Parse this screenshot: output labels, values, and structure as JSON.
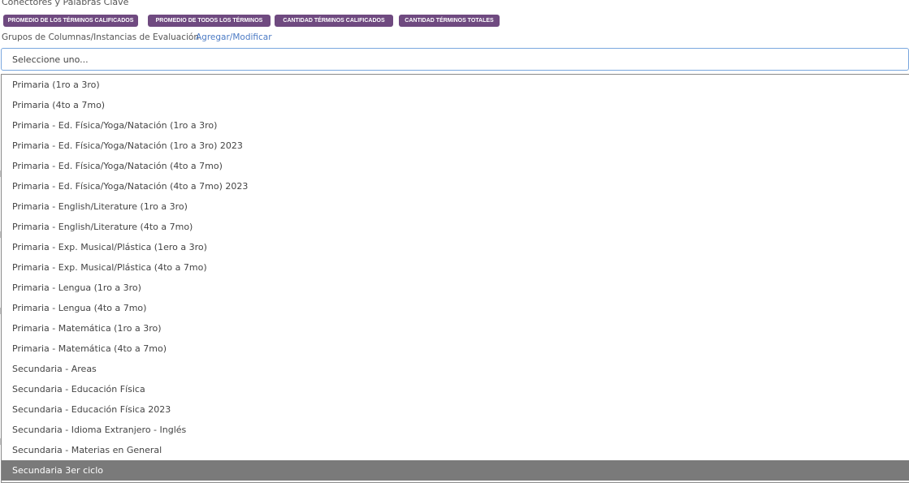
{
  "section_title": "Conectores y Palabras Clave",
  "report_buttons": [
    "PROMEDIO DE LOS TÉRMINOS CALIFICADOS",
    "PROMEDIO DE TODOS LOS TÉRMINOS",
    "CANTIDAD TÉRMINOS CALIFICADOS",
    "CANTIDAD TÉRMINOS TOTALES"
  ],
  "groups": {
    "label": "Grupos de Columnas/Instancias de Evaluación",
    "link": "Agregar/Modificar"
  },
  "select": {
    "placeholder": "Seleccione uno...",
    "options": [
      "Primaria (1ro a 3ro)",
      "Primaria (4to a 7mo)",
      "Primaria - Ed. Física/Yoga/Natación (1ro a 3ro)",
      "Primaria - Ed. Física/Yoga/Natación (1ro a 3ro) 2023",
      "Primaria - Ed. Física/Yoga/Natación (4to a 7mo)",
      "Primaria - Ed. Física/Yoga/Natación (4to a 7mo) 2023",
      "Primaria - English/Literature (1ro a 3ro)",
      "Primaria - English/Literature (4to a 7mo)",
      "Primaria - Exp. Musical/Plástica (1ero a 3ro)",
      "Primaria - Exp. Musical/Plástica (4to a 7mo)",
      "Primaria - Lengua (1ro a 3ro)",
      "Primaria - Lengua (4to a 7mo)",
      "Primaria - Matemática (1ro a 3ro)",
      "Primaria - Matemática (4to a 7mo)",
      "Secundaria - Areas",
      "Secundaria - Educación Física",
      "Secundaria - Educación Física 2023",
      "Secundaria - Idioma Extranjero - Inglés",
      "Secundaria - Materias en General",
      "Secundaria 3er ciclo"
    ],
    "highlighted_option": "Secundaria 3er ciclo"
  },
  "colors": {
    "accent_purple": "#6f4a80",
    "link_blue": "#4b7ac4",
    "highlight_gray": "#7a7a7a"
  }
}
